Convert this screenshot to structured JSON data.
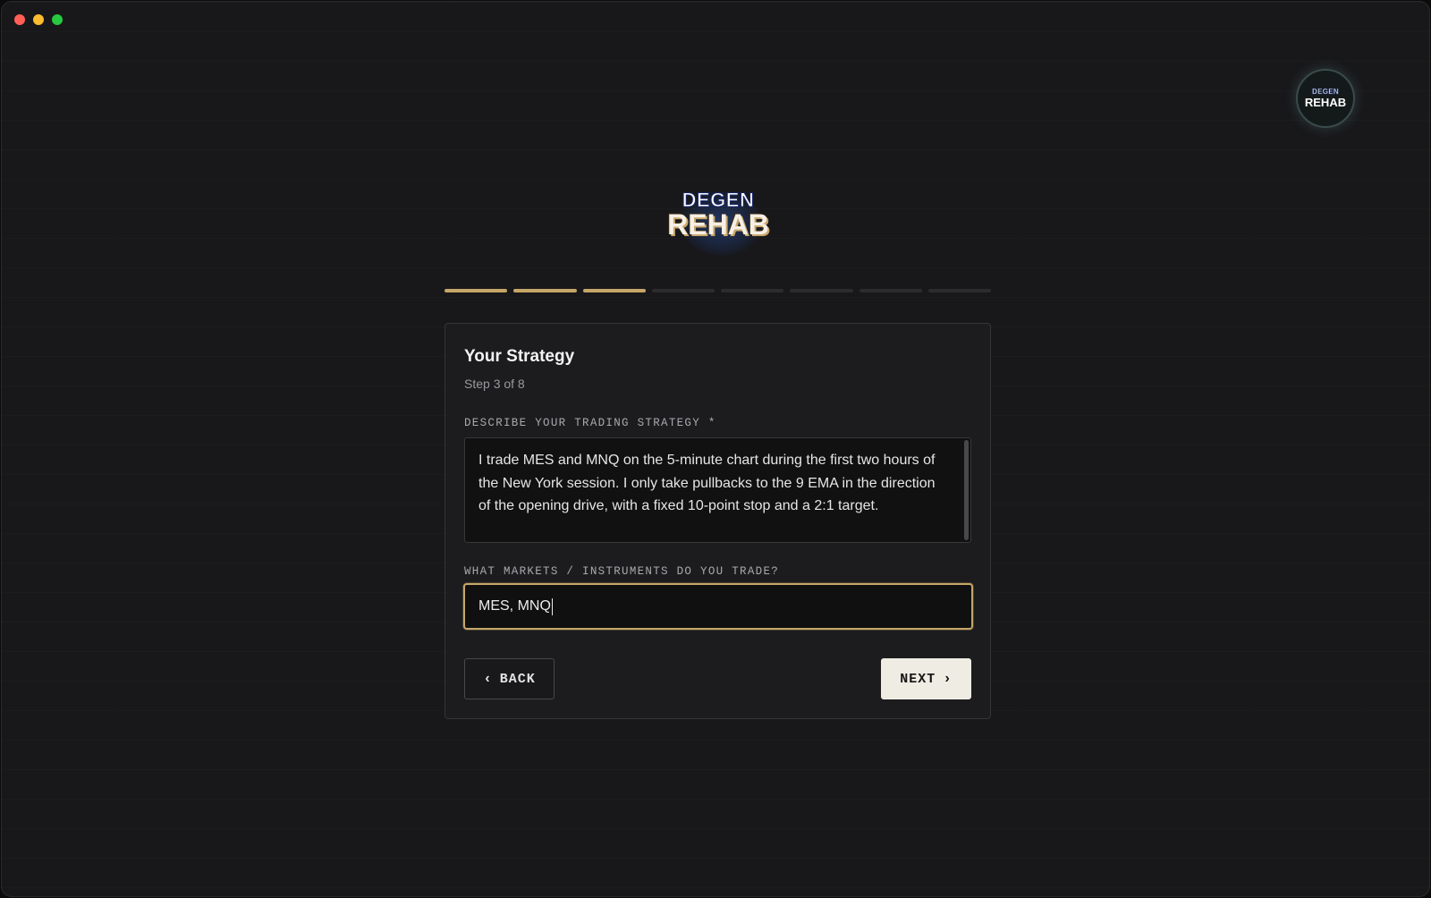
{
  "brand": {
    "logo_top": "DEGEN",
    "logo_bottom": "REHAB",
    "avatar_top": "DEGEN",
    "avatar_bottom": "REHAB"
  },
  "progress": {
    "total_steps": 8,
    "completed_steps": 3,
    "accent_color": "#c6a668"
  },
  "form": {
    "title": "Your Strategy",
    "step_text": "Step 3 of 8",
    "strategy_label": "DESCRIBE YOUR TRADING STRATEGY *",
    "strategy_value": "I trade MES and MNQ on the 5-minute chart during the first two hours of the New York session. I only take pullbacks to the 9 EMA in the direction of the opening drive, with a fixed 10-point stop and a 2:1 target.",
    "markets_label": "WHAT MARKETS / INSTRUMENTS DO YOU TRADE?",
    "markets_value": "MES, MNQ"
  },
  "buttons": {
    "back_label": "BACK",
    "next_label": "NEXT",
    "back_icon": "chevron-left-icon",
    "next_icon": "chevron-right-icon"
  }
}
